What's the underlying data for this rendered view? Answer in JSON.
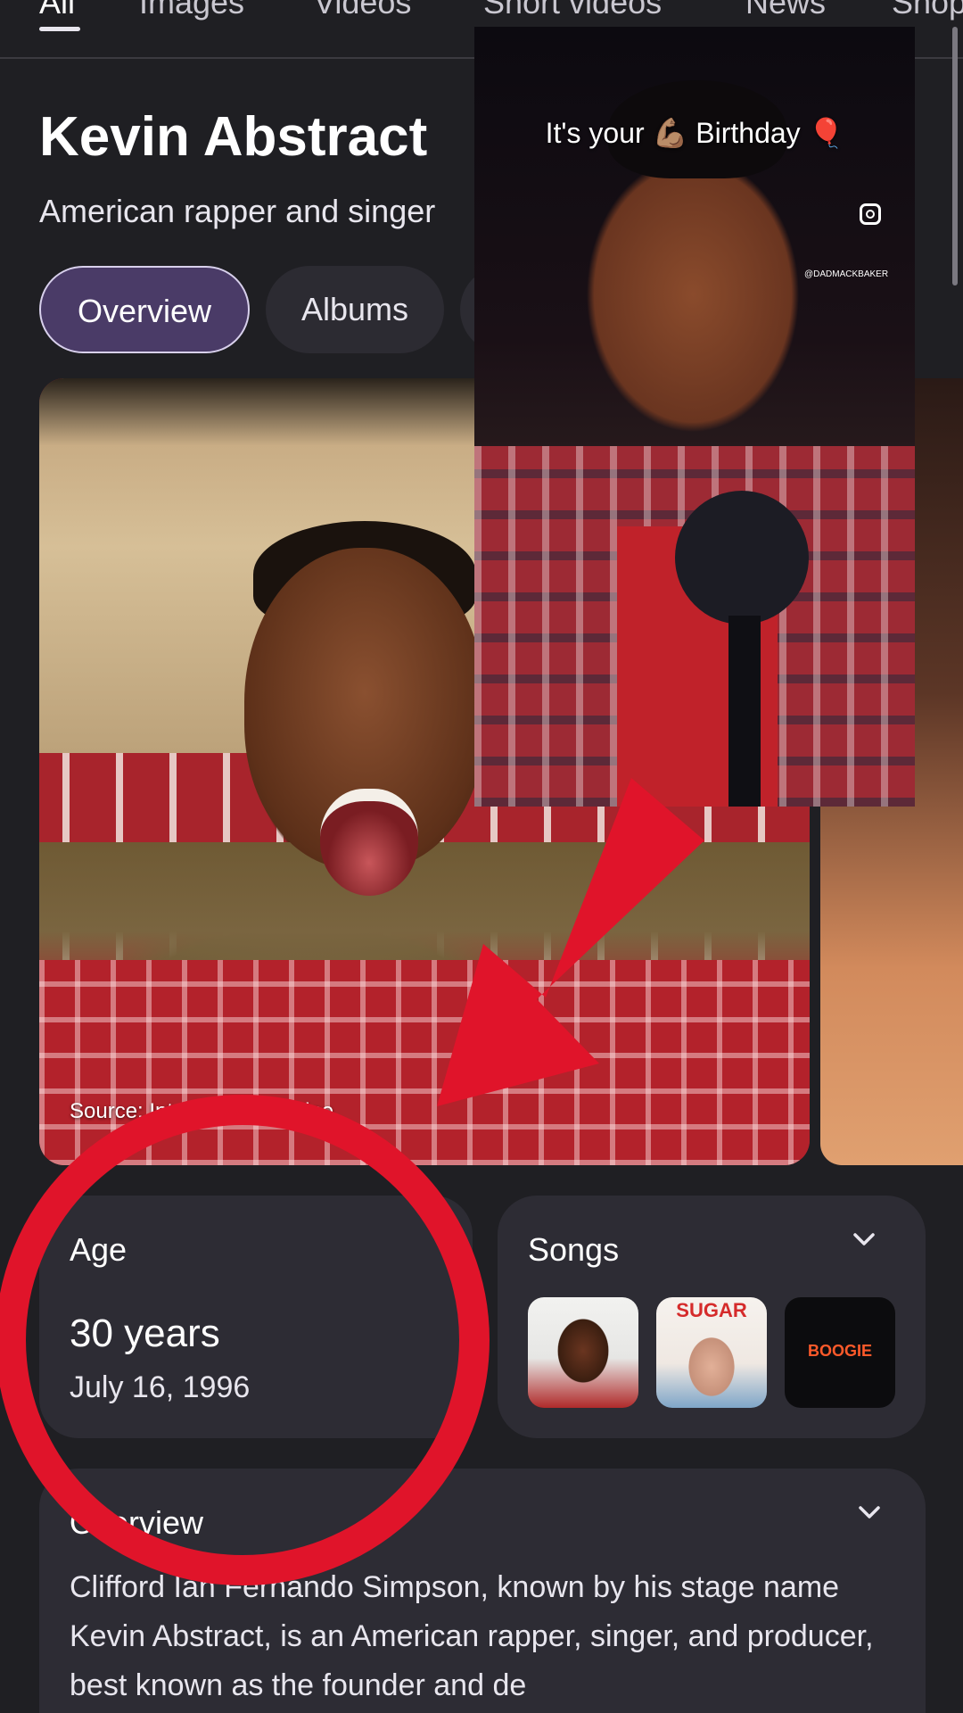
{
  "tabs": {
    "items": [
      "All",
      "Images",
      "Videos",
      "Short videos",
      "News",
      "Shop"
    ]
  },
  "entity": {
    "name": "Kevin Abstract",
    "description": "American rapper and singer"
  },
  "chips": {
    "overview": "Overview",
    "albums": "Albums"
  },
  "media": {
    "source": "Source: Interview Magazine"
  },
  "video": {
    "caption": "It's your 💪🏽 Birthday 🎈",
    "handle": "@DADMACKBAKER",
    "icon": "instagram-icon"
  },
  "age_card": {
    "label": "Age",
    "value": "30 years",
    "date": "July 16, 1996"
  },
  "songs_card": {
    "label": "Songs",
    "thumbs": [
      "",
      "SUGAR",
      "BOOGIE"
    ]
  },
  "overview_card": {
    "label": "Overview",
    "text": "Clifford Ian Fernando Simpson, known by his stage name Kevin Abstract, is an American rapper, singer, and producer, best known as the founder and de"
  },
  "colors": {
    "background": "#1f1f23",
    "card": "#2d2c34",
    "chip_active": "#4a3b67",
    "annotation_red": "#e0142a"
  }
}
